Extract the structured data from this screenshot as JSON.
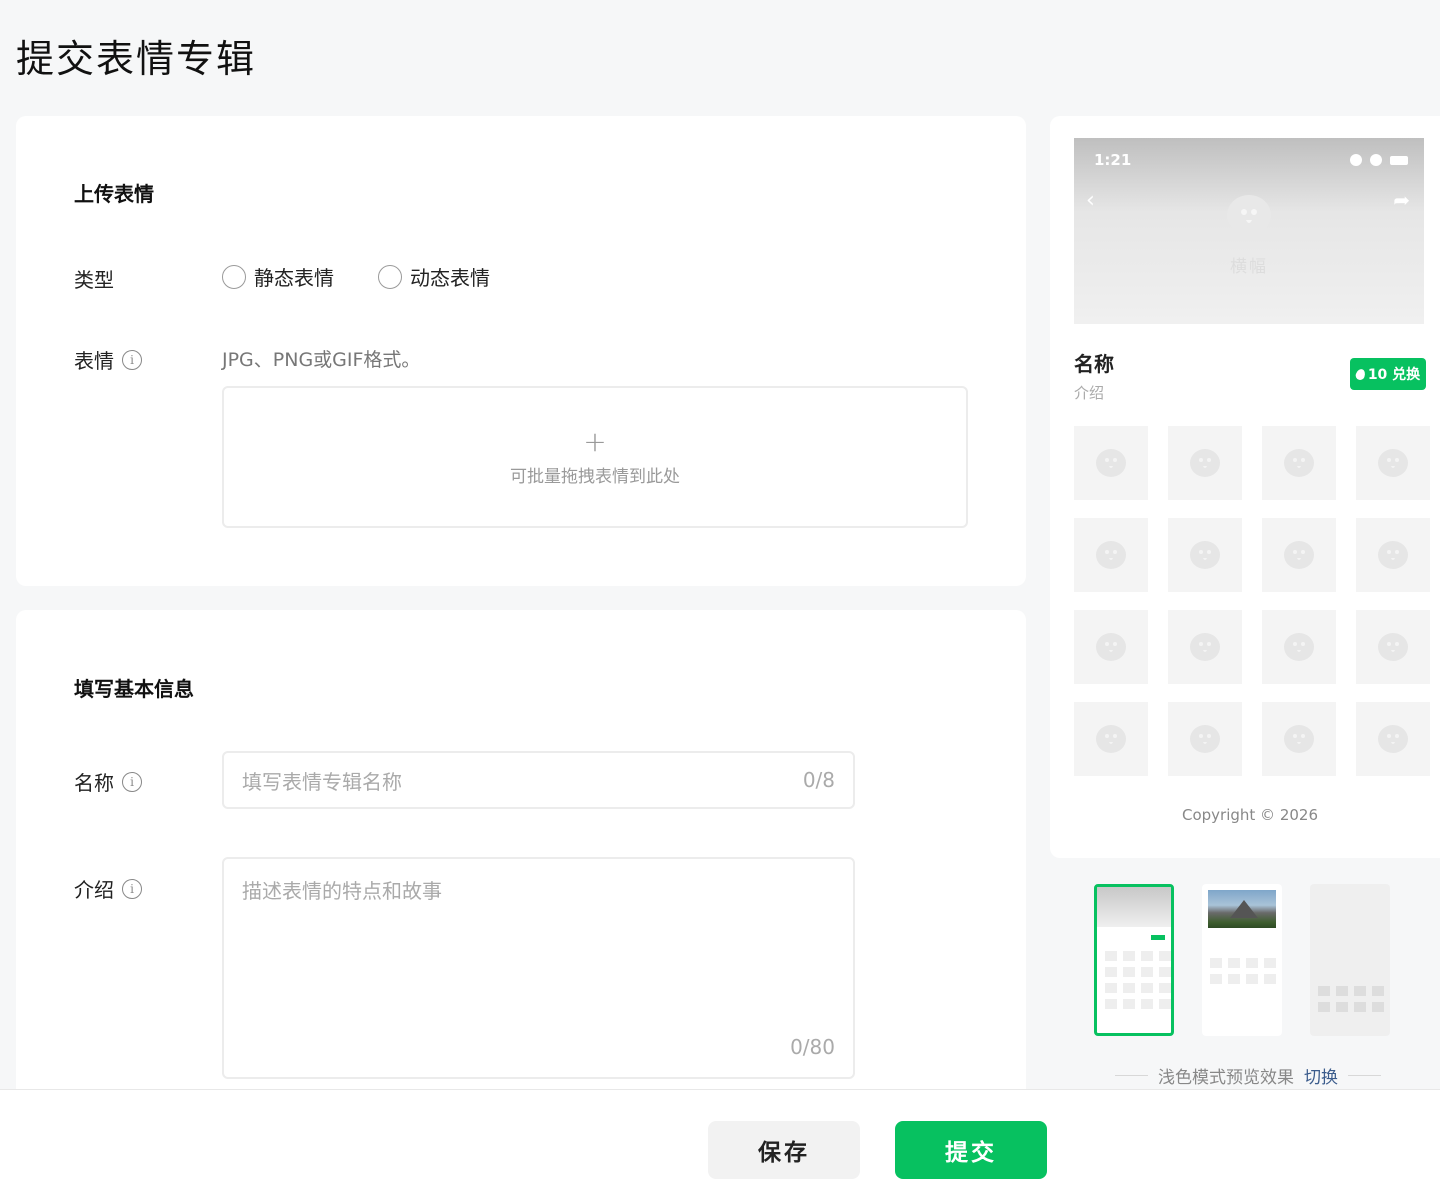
{
  "page": {
    "title": "提交表情专辑"
  },
  "upload": {
    "section_title": "上传表情",
    "type_label": "类型",
    "type_options": [
      "静态表情",
      "动态表情"
    ],
    "sticker_label": "表情",
    "hint": "JPG、PNG或GIF格式。",
    "dropzone_plus": "+",
    "dropzone_text": "可批量拖拽表情到此处"
  },
  "basic": {
    "section_title": "填写基本信息",
    "name_label": "名称",
    "name_placeholder": "填写表情专辑名称",
    "name_counter": "0/8",
    "intro_label": "介绍",
    "intro_placeholder": "描述表情的特点和故事",
    "intro_counter": "0/80"
  },
  "preview": {
    "status_time": "1:21",
    "banner_label": "横幅",
    "name": "名称",
    "intro": "介绍",
    "badge": "10 兑换",
    "copyright": "Copyright © 2026",
    "mode_text": "浅色模式预览效果",
    "mode_switch": "切换"
  },
  "actions": {
    "save": "保存",
    "submit": "提交"
  },
  "colors": {
    "accent": "#07c160",
    "link": "#3b5c8c"
  },
  "icons": [
    "info-icon",
    "plus-icon",
    "back-arrow-icon",
    "share-icon",
    "sticker-placeholder-icon",
    "drop-icon"
  ]
}
